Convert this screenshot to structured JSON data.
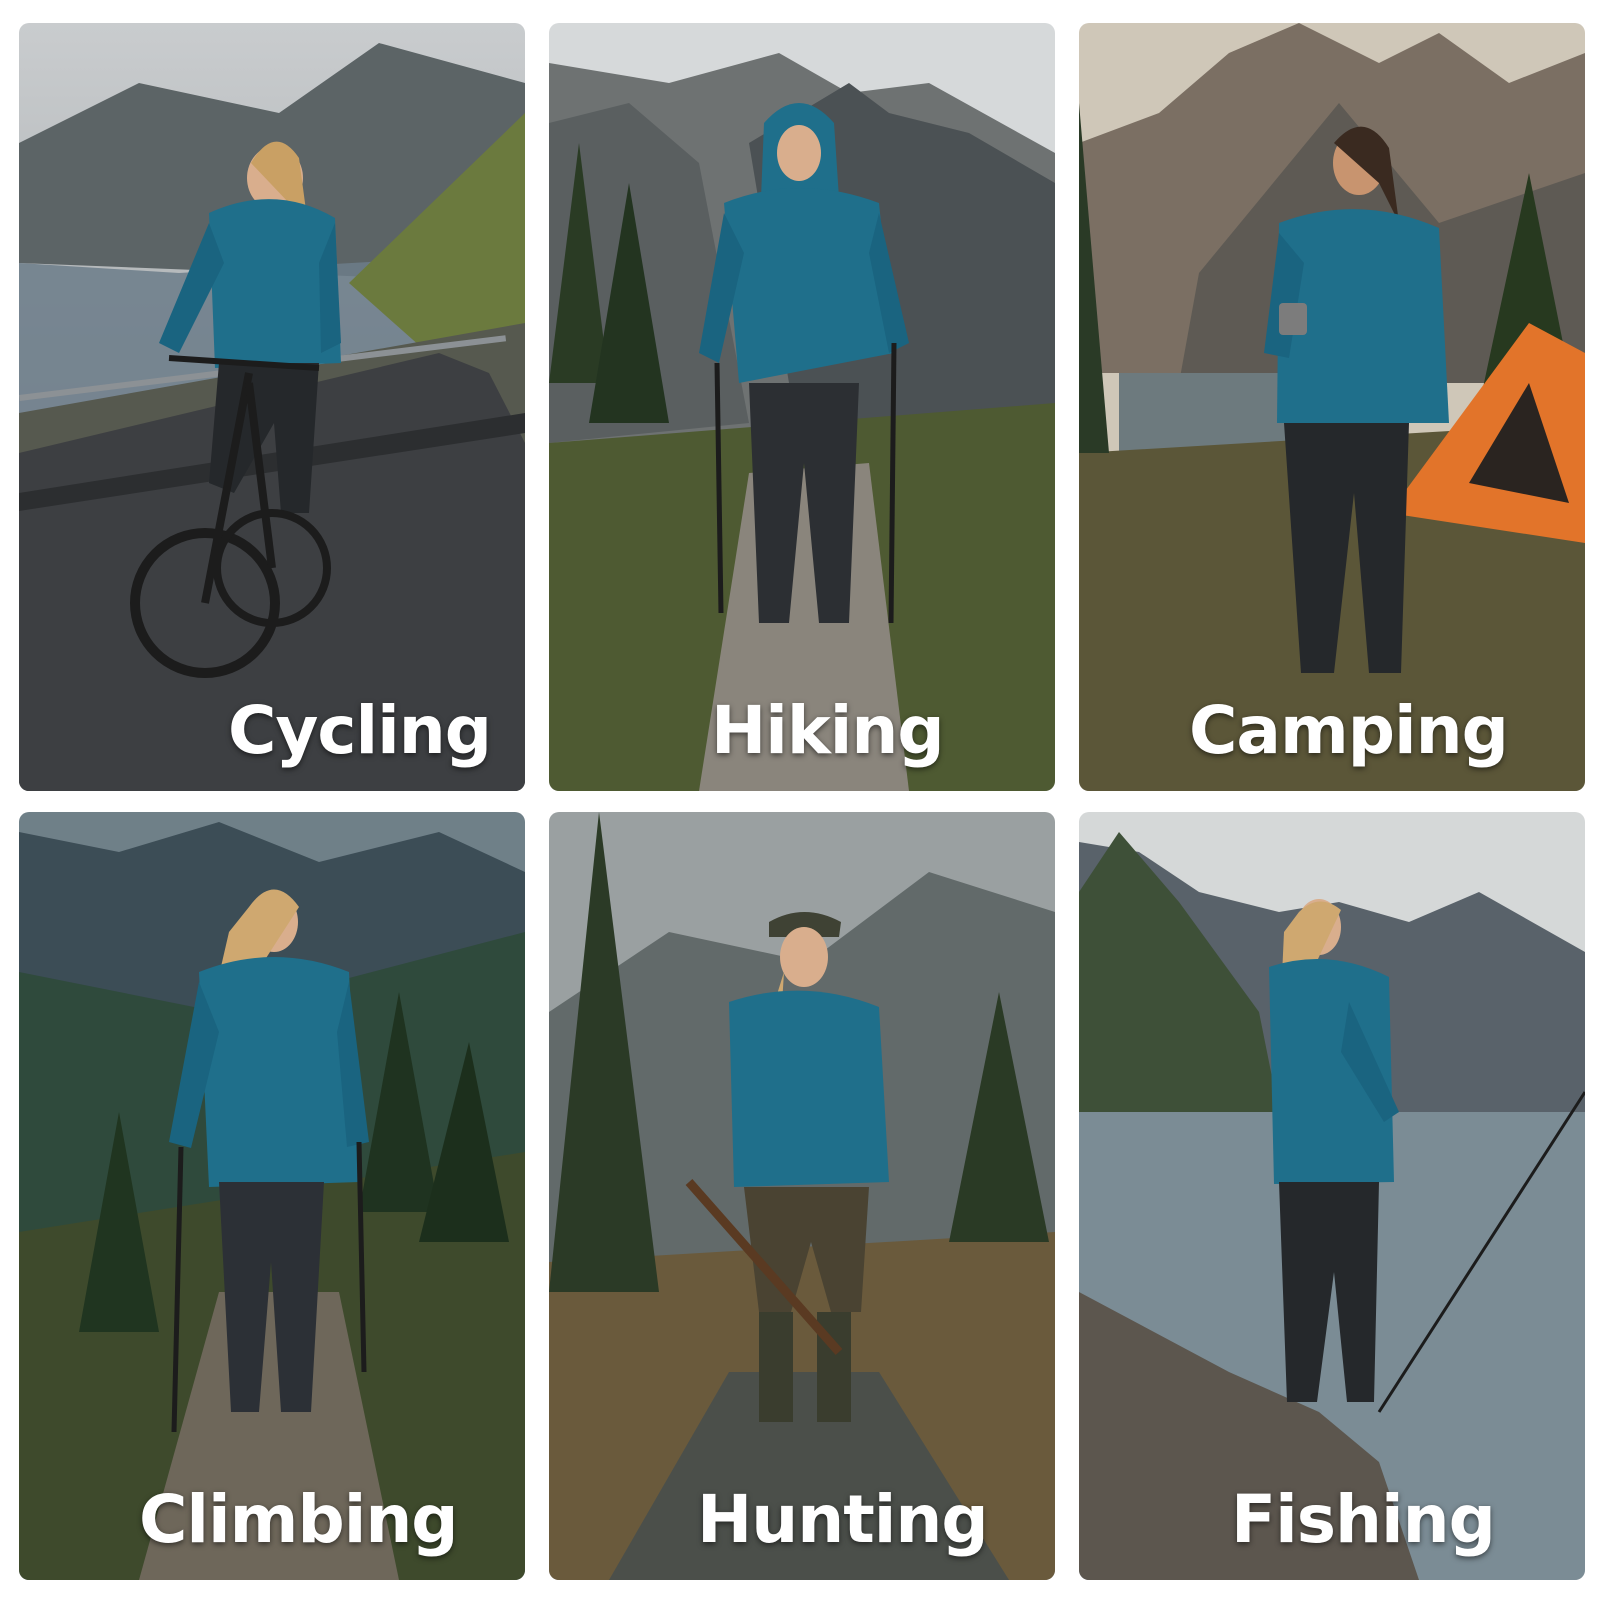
{
  "tiles": [
    {
      "id": "cycling",
      "label": "Cycling"
    },
    {
      "id": "hiking",
      "label": "Hiking"
    },
    {
      "id": "camping",
      "label": "Camping"
    },
    {
      "id": "climbing",
      "label": "Climbing"
    },
    {
      "id": "hunting",
      "label": "Hunting"
    },
    {
      "id": "fishing",
      "label": "Fishing"
    }
  ],
  "colors": {
    "jacket": "#1f6f8b",
    "pants": "#25282b",
    "tent": "#e2742a",
    "caption": "#ffffff"
  }
}
